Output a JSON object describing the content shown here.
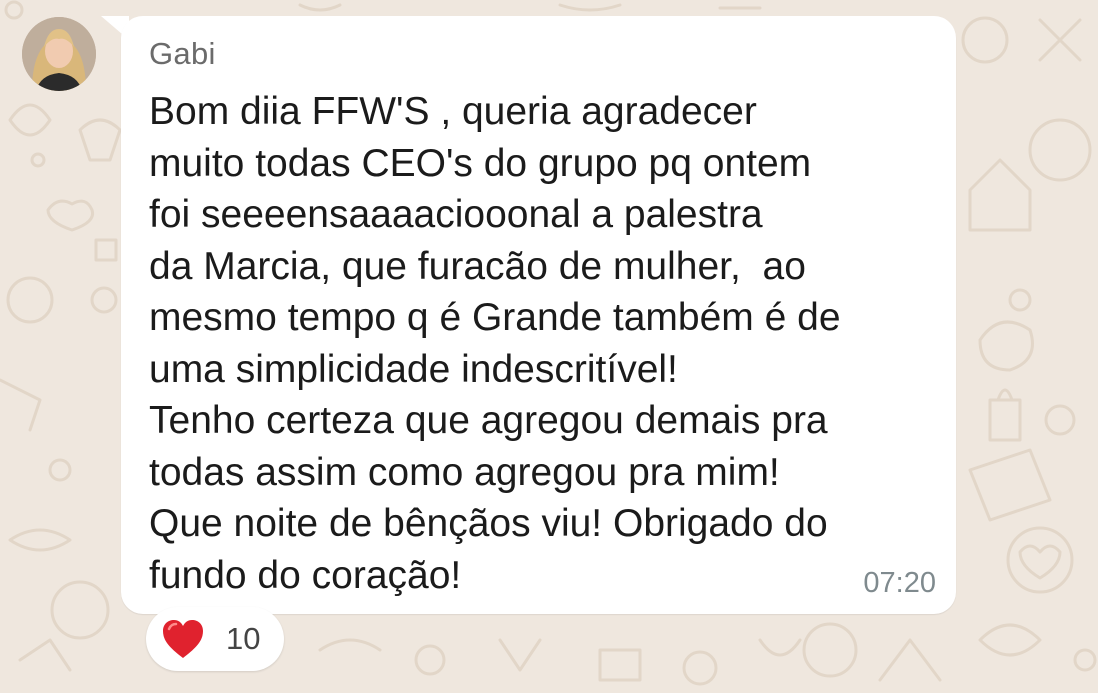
{
  "chat": {
    "sender_name": "Gabi",
    "avatar_icon": "person-avatar",
    "message_lines": [
      "Bom diia FFW'S , queria agradecer",
      "muito todas CEO's do grupo pq ontem",
      "foi seeeensaaaaciooonal a palestra",
      "da Marcia, que furacão de mulher,  ao",
      "mesmo tempo q é Grande também é de",
      "uma simplicidade indescritível!",
      "Tenho certeza que agregou demais pra",
      "todas assim como agregou pra mim!",
      "Que noite de bênçãos viu! Obrigado do",
      "fundo do coração!"
    ],
    "time": "07:20",
    "reaction": {
      "icon": "heart-icon",
      "count": "10"
    }
  },
  "colors": {
    "wallpaper": "#efe7de",
    "doodle": "#e2d6c8",
    "bubble": "#ffffff",
    "sender": "#6b6b6b",
    "time": "#7f8a8e",
    "heart": "#e0222e"
  }
}
